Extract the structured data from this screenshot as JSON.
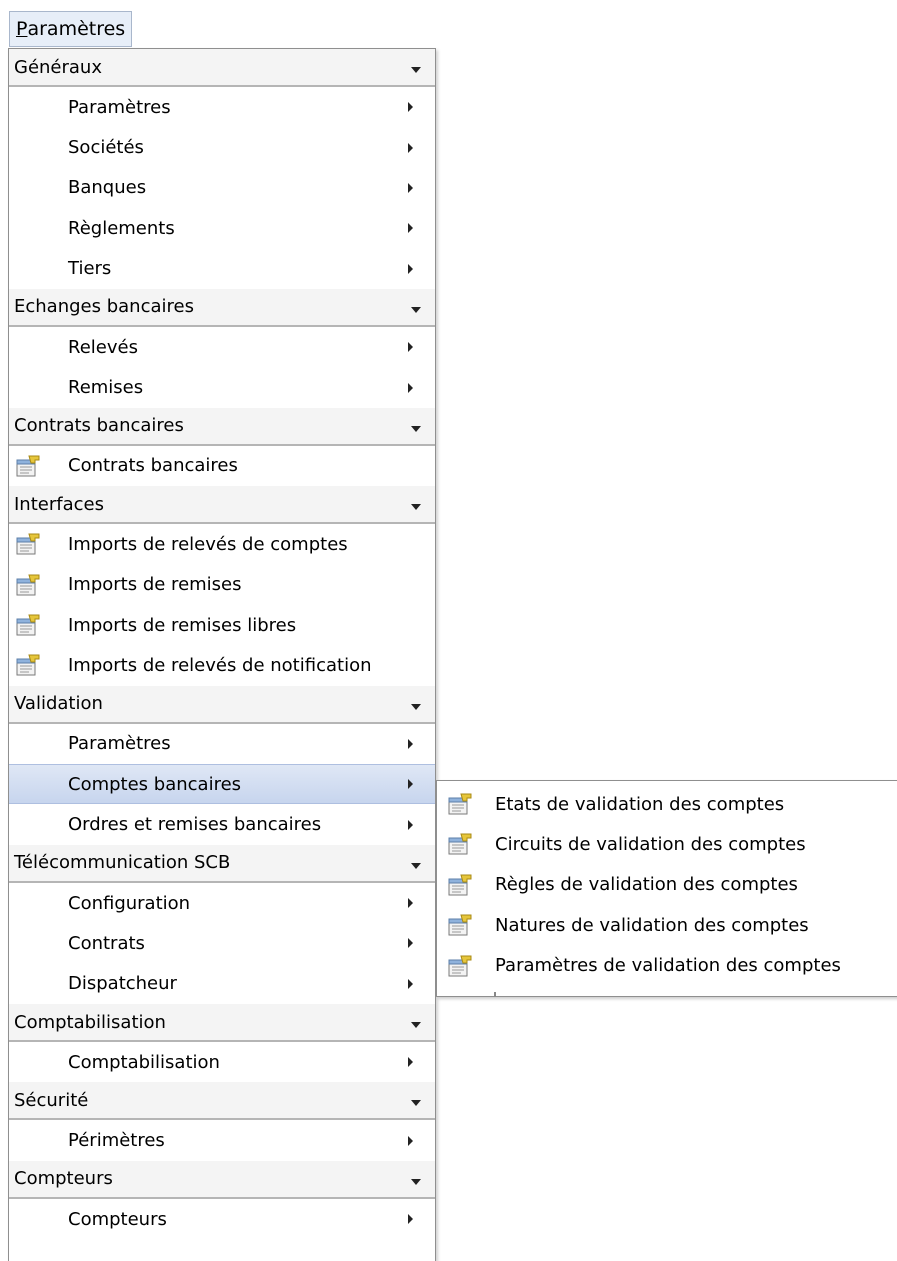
{
  "menubar": {
    "accelerator": "P",
    "rest": "aramètres"
  },
  "sections": [
    {
      "title": "Généraux",
      "items": [
        {
          "label": "Paramètres",
          "icon": null,
          "has_submenu": true
        },
        {
          "label": "Sociétés",
          "icon": null,
          "has_submenu": true
        },
        {
          "label": "Banques",
          "icon": null,
          "has_submenu": true
        },
        {
          "label": "Règlements",
          "icon": null,
          "has_submenu": true
        },
        {
          "label": "Tiers",
          "icon": null,
          "has_submenu": true
        }
      ]
    },
    {
      "title": "Echanges bancaires",
      "items": [
        {
          "label": "Relevés",
          "icon": null,
          "has_submenu": true
        },
        {
          "label": "Remises",
          "icon": null,
          "has_submenu": true
        }
      ]
    },
    {
      "title": "Contrats bancaires",
      "items": [
        {
          "label": "Contrats bancaires",
          "icon": "form-icon",
          "has_submenu": false
        }
      ]
    },
    {
      "title": "Interfaces",
      "items": [
        {
          "label": "Imports de relevés de comptes",
          "icon": "form-icon",
          "has_submenu": false
        },
        {
          "label": "Imports de remises",
          "icon": "form-icon",
          "has_submenu": false
        },
        {
          "label": "Imports de remises libres",
          "icon": "form-icon",
          "has_submenu": false
        },
        {
          "label": "Imports de relevés de notification",
          "icon": "form-icon",
          "has_submenu": false
        }
      ]
    },
    {
      "title": "Validation",
      "items": [
        {
          "label": "Paramètres",
          "icon": null,
          "has_submenu": true
        },
        {
          "label": "Comptes bancaires",
          "icon": null,
          "has_submenu": true,
          "highlighted": true
        },
        {
          "label": "Ordres et remises bancaires",
          "icon": null,
          "has_submenu": true
        }
      ]
    },
    {
      "title": "Télécommunication SCB",
      "items": [
        {
          "label": "Configuration",
          "icon": null,
          "has_submenu": true
        },
        {
          "label": "Contrats",
          "icon": null,
          "has_submenu": true
        },
        {
          "label": "Dispatcheur",
          "icon": null,
          "has_submenu": true
        }
      ]
    },
    {
      "title": "Comptabilisation",
      "items": [
        {
          "label": "Comptabilisation",
          "icon": null,
          "has_submenu": true
        }
      ]
    },
    {
      "title": "Sécurité",
      "items": [
        {
          "label": "Périmètres",
          "icon": null,
          "has_submenu": true
        }
      ]
    },
    {
      "title": "Compteurs",
      "items": [
        {
          "label": "Compteurs",
          "icon": null,
          "has_submenu": true
        }
      ]
    }
  ],
  "submenu": {
    "items": [
      {
        "label": "Etats de validation des comptes",
        "icon": "form-icon"
      },
      {
        "label": "Circuits de validation des comptes",
        "icon": "form-icon"
      },
      {
        "label": "Règles de validation des comptes",
        "icon": "form-icon"
      },
      {
        "label": "Natures de validation des comptes",
        "icon": "form-icon"
      },
      {
        "label": "Paramètres de validation des comptes",
        "icon": "form-icon"
      }
    ]
  },
  "colors": {
    "highlight": "#c7d5ee",
    "menubar_bg": "#e7eef8"
  }
}
